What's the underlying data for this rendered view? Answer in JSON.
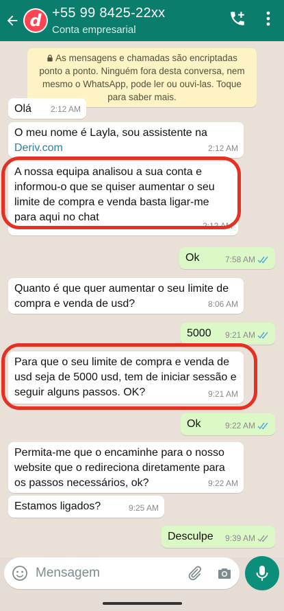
{
  "header": {
    "contact_name": "+55 99 8425-22xx",
    "contact_subtitle": "Conta empresarial",
    "avatar_letter": "d",
    "accent_color": "#0a7d6c"
  },
  "notice": {
    "text": "As mensagens e chamadas são encriptadas ponto a ponto. Ninguém fora desta conversa, nem mesmo o WhatsApp, pode ler ou ouvi-las. Toque para saber mais."
  },
  "messages": [
    {
      "direction": "in",
      "text": "Olá",
      "time": "2:12 AM"
    },
    {
      "direction": "in",
      "text_before_link": "O meu nome é Layla, sou assistente na ",
      "link": "Deriv.com",
      "time": "2:12 AM"
    },
    {
      "direction": "in",
      "text": "A nossa equipa analisou a sua conta e informou-o que se quiser aumentar o seu limite de compra e venda basta ligar-me para aqui no chat",
      "time": "2:12 AM",
      "highlighted": true
    },
    {
      "direction": "out",
      "text": "Ok",
      "time": "7:58 AM",
      "status": "read"
    },
    {
      "direction": "in",
      "text": "Quanto é que quer aumentar o seu limite de compra e venda de usd?",
      "time": "8:06 AM"
    },
    {
      "direction": "out",
      "text": "5000",
      "time": "9:21 AM",
      "status": "read"
    },
    {
      "direction": "in",
      "text": "Para que o seu limite de compra e venda de usd seja de 5000 usd, tem de iniciar sessão e seguir alguns passos. OK?",
      "time": "9:21 AM",
      "highlighted": true
    },
    {
      "direction": "out",
      "text": "Ok",
      "time": "9:22 AM",
      "status": "read"
    },
    {
      "direction": "in",
      "text": "Permita-me que o encaminhe para o nosso website que o redireciona diretamente para os passos necessários, ok?",
      "time": "9:22 AM"
    },
    {
      "direction": "in",
      "text": "Estamos ligados?",
      "time": "9:25 AM"
    },
    {
      "direction": "out",
      "text": "Desculpe",
      "time": "9:39 AM",
      "status": "delivered"
    }
  ],
  "composer": {
    "placeholder": "Mensagem"
  },
  "icons": [
    "back-arrow-icon",
    "add-call-icon",
    "more-vert-icon",
    "lock-icon",
    "emoji-icon",
    "attach-icon",
    "camera-icon",
    "mic-icon",
    "read-ticks-icon"
  ],
  "colors": {
    "incoming_bubble": "#ffffff",
    "outgoing_bubble": "#dcf8c6",
    "highlight_ring": "#e53024",
    "read_tick": "#4fa6e0"
  }
}
